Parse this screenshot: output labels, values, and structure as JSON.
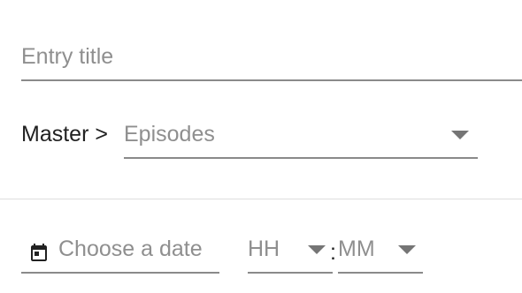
{
  "title_field": {
    "placeholder": "Entry title"
  },
  "breadcrumb": {
    "prefix": "Master >",
    "selected": "Episodes"
  },
  "date_picker": {
    "placeholder": "Choose a date",
    "icon": "calendar-icon"
  },
  "time_picker": {
    "hours_placeholder": "HH",
    "separator": ":",
    "minutes_placeholder": "MM"
  },
  "colors": {
    "text": "#212121",
    "placeholder": "#8f8f8f",
    "underline": "#8a8a8a",
    "divider": "#dedede",
    "icon": "#757575"
  }
}
